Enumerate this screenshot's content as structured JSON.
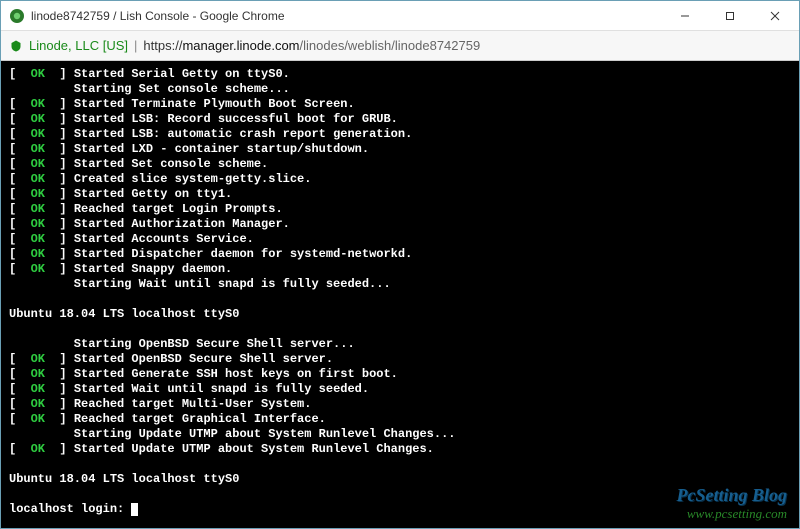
{
  "window": {
    "title": "linode8742759 / Lish Console - Google Chrome"
  },
  "address": {
    "ev_org": "Linode, LLC [US]",
    "separator": "|",
    "scheme": "https://",
    "host": "manager.linode.com",
    "path": "/linodes/weblish/linode8742759"
  },
  "terminal": {
    "ok_label": "OK",
    "lines": [
      {
        "type": "ok",
        "text": "Started Serial Getty on ttyS0."
      },
      {
        "type": "plain",
        "indent": true,
        "text": "Starting Set console scheme..."
      },
      {
        "type": "ok",
        "text": "Started Terminate Plymouth Boot Screen."
      },
      {
        "type": "ok",
        "text": "Started LSB: Record successful boot for GRUB."
      },
      {
        "type": "ok",
        "text": "Started LSB: automatic crash report generation."
      },
      {
        "type": "ok",
        "text": "Started LXD - container startup/shutdown."
      },
      {
        "type": "ok",
        "text": "Started Set console scheme."
      },
      {
        "type": "ok",
        "text": "Created slice system-getty.slice."
      },
      {
        "type": "ok",
        "text": "Started Getty on tty1."
      },
      {
        "type": "ok",
        "text": "Reached target Login Prompts."
      },
      {
        "type": "ok",
        "text": "Started Authorization Manager."
      },
      {
        "type": "ok",
        "text": "Started Accounts Service."
      },
      {
        "type": "ok",
        "text": "Started Dispatcher daemon for systemd-networkd."
      },
      {
        "type": "ok",
        "text": "Started Snappy daemon."
      },
      {
        "type": "plain",
        "indent": true,
        "text": "Starting Wait until snapd is fully seeded..."
      },
      {
        "type": "blank"
      },
      {
        "type": "raw",
        "text": "Ubuntu 18.04 LTS localhost ttyS0"
      },
      {
        "type": "blank"
      },
      {
        "type": "plain",
        "indent": true,
        "text": "Starting OpenBSD Secure Shell server..."
      },
      {
        "type": "ok",
        "text": "Started OpenBSD Secure Shell server."
      },
      {
        "type": "ok",
        "text": "Started Generate SSH host keys on first boot."
      },
      {
        "type": "ok",
        "text": "Started Wait until snapd is fully seeded."
      },
      {
        "type": "ok",
        "text": "Reached target Multi-User System."
      },
      {
        "type": "ok",
        "text": "Reached target Graphical Interface."
      },
      {
        "type": "plain",
        "indent": true,
        "text": "Starting Update UTMP about System Runlevel Changes..."
      },
      {
        "type": "ok",
        "text": "Started Update UTMP about System Runlevel Changes."
      },
      {
        "type": "blank"
      },
      {
        "type": "raw",
        "text": "Ubuntu 18.04 LTS localhost ttyS0"
      },
      {
        "type": "blank"
      },
      {
        "type": "prompt",
        "text": "localhost login: "
      }
    ]
  },
  "watermark": {
    "line1": "PcSetting Blog",
    "line2": "www.pcsetting.com"
  }
}
